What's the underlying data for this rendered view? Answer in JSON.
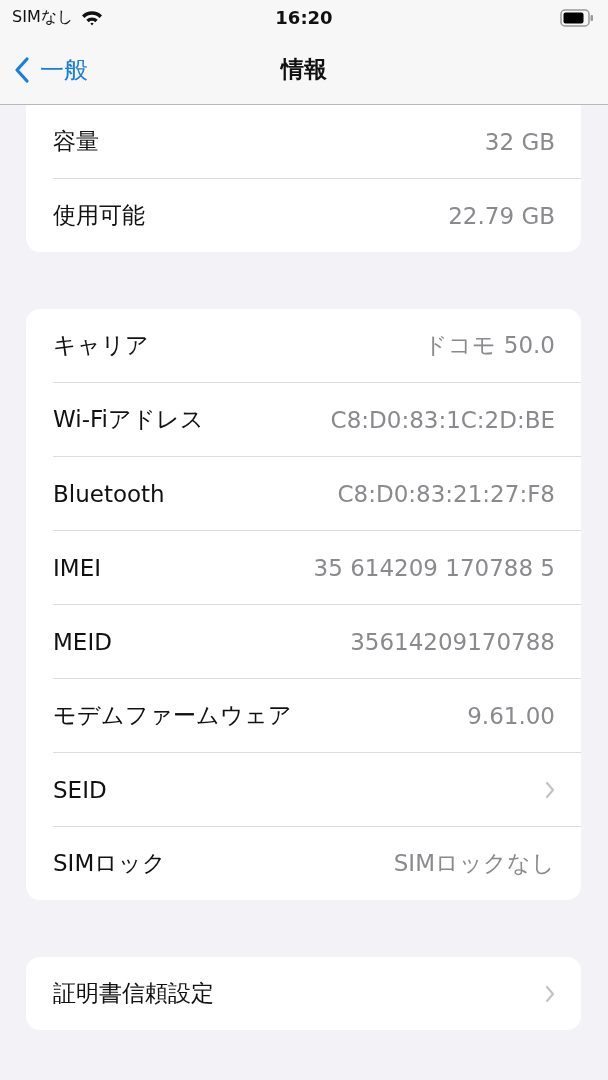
{
  "status_bar": {
    "carrier": "SIMなし",
    "time": "16:20"
  },
  "nav": {
    "back": "一般",
    "title": "情報"
  },
  "groups": [
    {
      "rows": [
        {
          "kind": "value",
          "label": "容量",
          "value": "32 GB"
        },
        {
          "kind": "value",
          "label": "使用可能",
          "value": "22.79 GB"
        }
      ]
    },
    {
      "rows": [
        {
          "kind": "value",
          "label": "キャリア",
          "value": "ドコモ 50.0"
        },
        {
          "kind": "value",
          "label": "Wi-Fiアドレス",
          "value": "C8:D0:83:1C:2D:BE"
        },
        {
          "kind": "value",
          "label": "Bluetooth",
          "value": "C8:D0:83:21:27:F8"
        },
        {
          "kind": "value",
          "label": "IMEI",
          "value": "35 614209 170788 5"
        },
        {
          "kind": "value",
          "label": "MEID",
          "value": "35614209170788"
        },
        {
          "kind": "value",
          "label": "モデムファームウェア",
          "value": "9.61.00"
        },
        {
          "kind": "link",
          "label": "SEID"
        },
        {
          "kind": "value",
          "label": "SIMロック",
          "value": "SIMロックなし"
        }
      ]
    },
    {
      "rows": [
        {
          "kind": "link",
          "label": "証明書信頼設定"
        }
      ]
    }
  ]
}
